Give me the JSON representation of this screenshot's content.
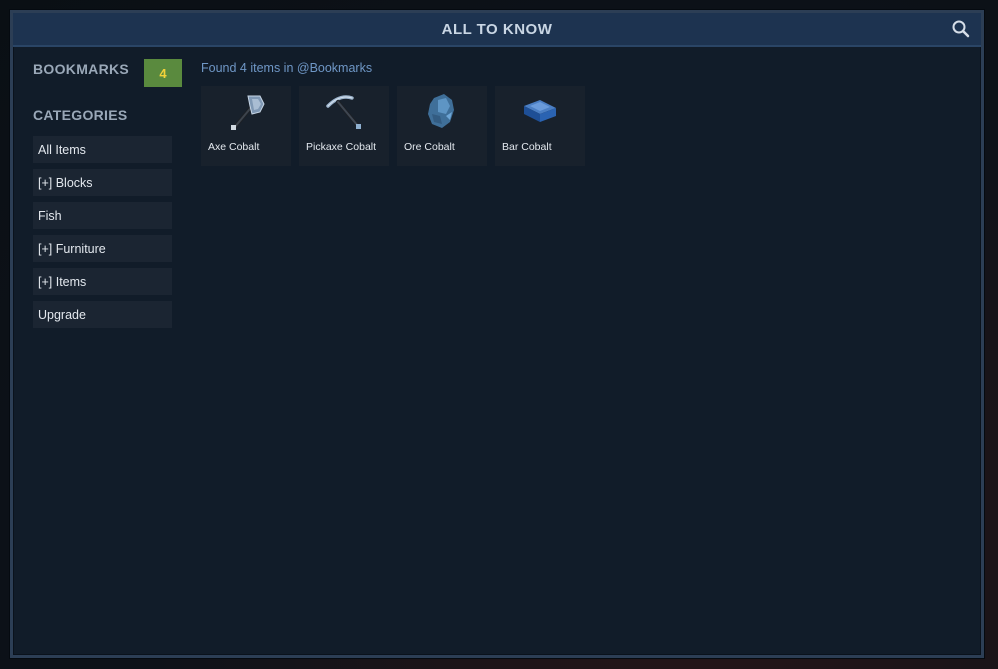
{
  "window": {
    "title": "ALL TO KNOW"
  },
  "icons": {
    "search": "search-icon",
    "axe": "cobalt-axe-icon",
    "pickaxe": "cobalt-pickaxe-icon",
    "ore": "cobalt-ore-icon",
    "bar": "cobalt-bar-icon"
  },
  "sidebar": {
    "bookmarks_label": "BOOKMARKS",
    "bookmarks_count": "4",
    "categories_label": "CATEGORIES",
    "categories": [
      {
        "label": "All Items"
      },
      {
        "label": "[+] Blocks"
      },
      {
        "label": "Fish"
      },
      {
        "label": "[+] Furniture"
      },
      {
        "label": "[+] Items"
      },
      {
        "label": "Upgrade"
      }
    ]
  },
  "main": {
    "found_text": "Found 4 items in @Bookmarks",
    "items": [
      {
        "name": "Axe Cobalt"
      },
      {
        "name": "Pickaxe Cobalt"
      },
      {
        "name": "Ore Cobalt"
      },
      {
        "name": "Bar Cobalt"
      }
    ]
  },
  "colors": {
    "title_bar": "#1d3350",
    "panel_bg": "#111c29",
    "bookmark_badge": "#5a8a3e",
    "bookmark_count_text": "#f2d23a",
    "found_text": "#6f97c6"
  }
}
